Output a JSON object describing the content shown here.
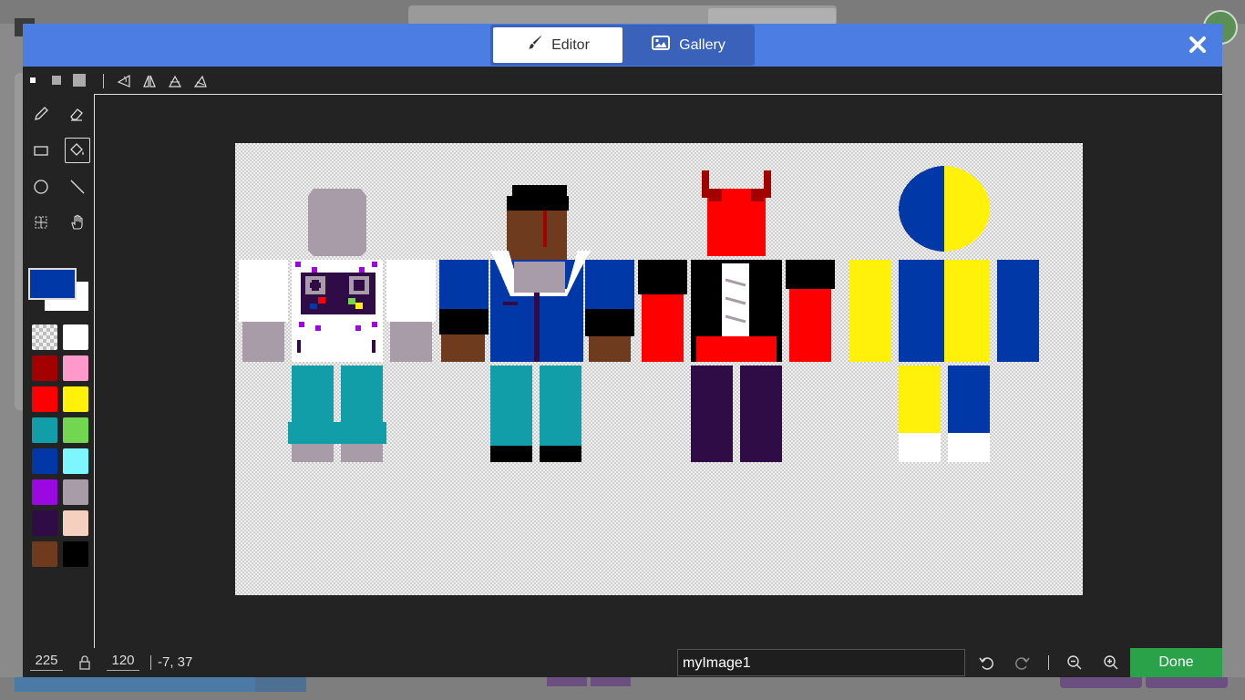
{
  "tabs": {
    "editor": "Editor",
    "gallery": "Gallery"
  },
  "palette": [
    {
      "name": "transparent",
      "color": "transparent"
    },
    {
      "name": "white",
      "color": "#ffffff"
    },
    {
      "name": "dark-red",
      "color": "#a30000"
    },
    {
      "name": "pink",
      "color": "#ff99cc"
    },
    {
      "name": "red",
      "color": "#ff0000"
    },
    {
      "name": "yellow",
      "color": "#fff10a"
    },
    {
      "name": "teal",
      "color": "#129ea9"
    },
    {
      "name": "green",
      "color": "#73d651"
    },
    {
      "name": "blue",
      "color": "#0038a8"
    },
    {
      "name": "light-cyan",
      "color": "#7df6ff"
    },
    {
      "name": "purple",
      "color": "#9a0ae0"
    },
    {
      "name": "grey-mauve",
      "color": "#a99ca9"
    },
    {
      "name": "dark-purple",
      "color": "#2f0c45"
    },
    {
      "name": "peach",
      "color": "#f5cfc0"
    },
    {
      "name": "brown",
      "color": "#6e3b1f"
    },
    {
      "name": "black",
      "color": "#000000"
    }
  ],
  "colors": {
    "primary": "#0038a8",
    "secondary": "#ffffff",
    "header": "#4b7de3",
    "done": "#2aa24a"
  },
  "footer": {
    "width": "225",
    "height": "120",
    "cursor_coords": "-7, 37",
    "image_name": "myImage1",
    "done_label": "Done"
  }
}
